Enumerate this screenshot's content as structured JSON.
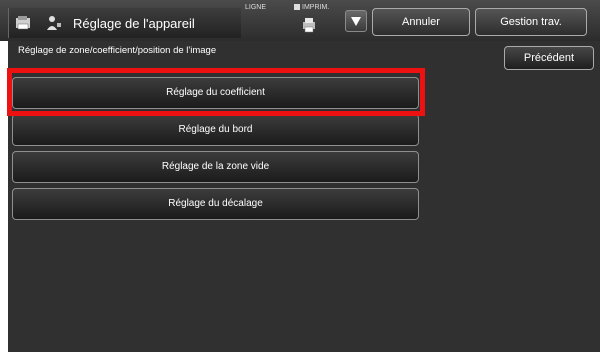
{
  "header": {
    "title": "Réglage de l'appareil",
    "status_ligne": "LIGNE",
    "status_imprim": "IMPRIM.",
    "cancel_label": "Annuler",
    "jobs_label": "Gestion trav."
  },
  "content": {
    "subtitle": "Réglage de zone/coefficient/position de l'image",
    "back_label": "Précédent",
    "menu": [
      {
        "label": "Réglage du coefficient",
        "highlighted": true
      },
      {
        "label": "Réglage du bord",
        "highlighted": false
      },
      {
        "label": "Réglage de la zone vide",
        "highlighted": false
      },
      {
        "label": "Réglage du décalage",
        "highlighted": false
      }
    ]
  },
  "icons": [
    "copier-icon",
    "person-settings-icon",
    "printer-icon",
    "dropdown-arrow-icon"
  ],
  "colors": {
    "highlight": "#ee1111",
    "panel": "#303030",
    "topbar": "#3a3a3a"
  }
}
